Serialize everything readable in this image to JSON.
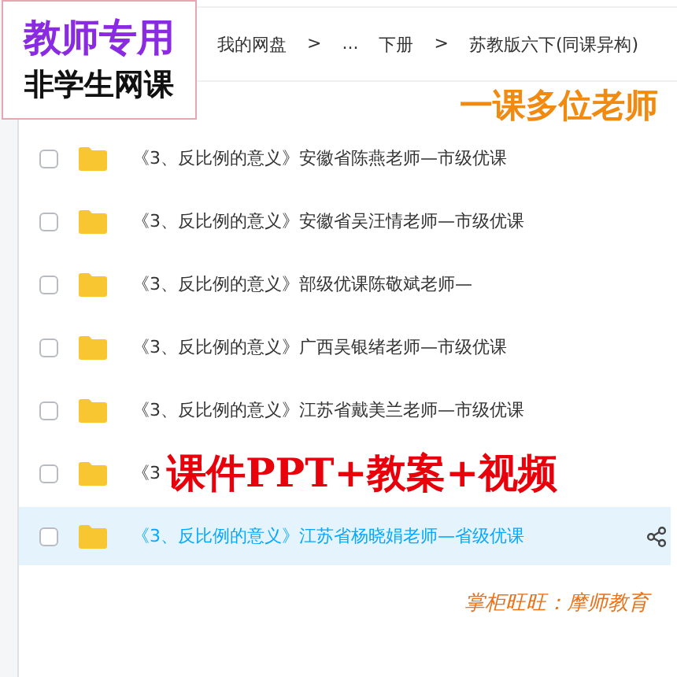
{
  "badge": {
    "line_1": "教师专用",
    "line_2": "非学生网课"
  },
  "breadcrumb": [
    "我的网盘",
    ">",
    "...",
    "下册",
    ">",
    "苏教版六下(同课异构)"
  ],
  "slogan": "一课多位老师",
  "files": [
    {
      "name": "《3、反比例的意义》安徽省陈燕老师—市级优课",
      "checked": false,
      "selected": false
    },
    {
      "name": "《3、反比例的意义》安徽省吴汪情老师—市级优课",
      "checked": false,
      "selected": false
    },
    {
      "name": "《3、反比例的意义》部级优课陈敬斌老师—",
      "checked": false,
      "selected": false
    },
    {
      "name": "《3、反比例的意义》广西吴银绪老师—市级优课",
      "checked": false,
      "selected": false
    },
    {
      "name": "《3、反比例的意义》江苏省戴美兰老师—市级优课",
      "checked": false,
      "selected": false
    },
    {
      "name": "《3",
      "checked": false,
      "selected": false
    },
    {
      "name": "《3、反比例的意义》江苏省杨晓娟老师—省级优课",
      "checked": false,
      "selected": true
    }
  ],
  "banner": "课件PPT+教案+视频",
  "shop_note": "掌柜旺旺：摩师教育"
}
